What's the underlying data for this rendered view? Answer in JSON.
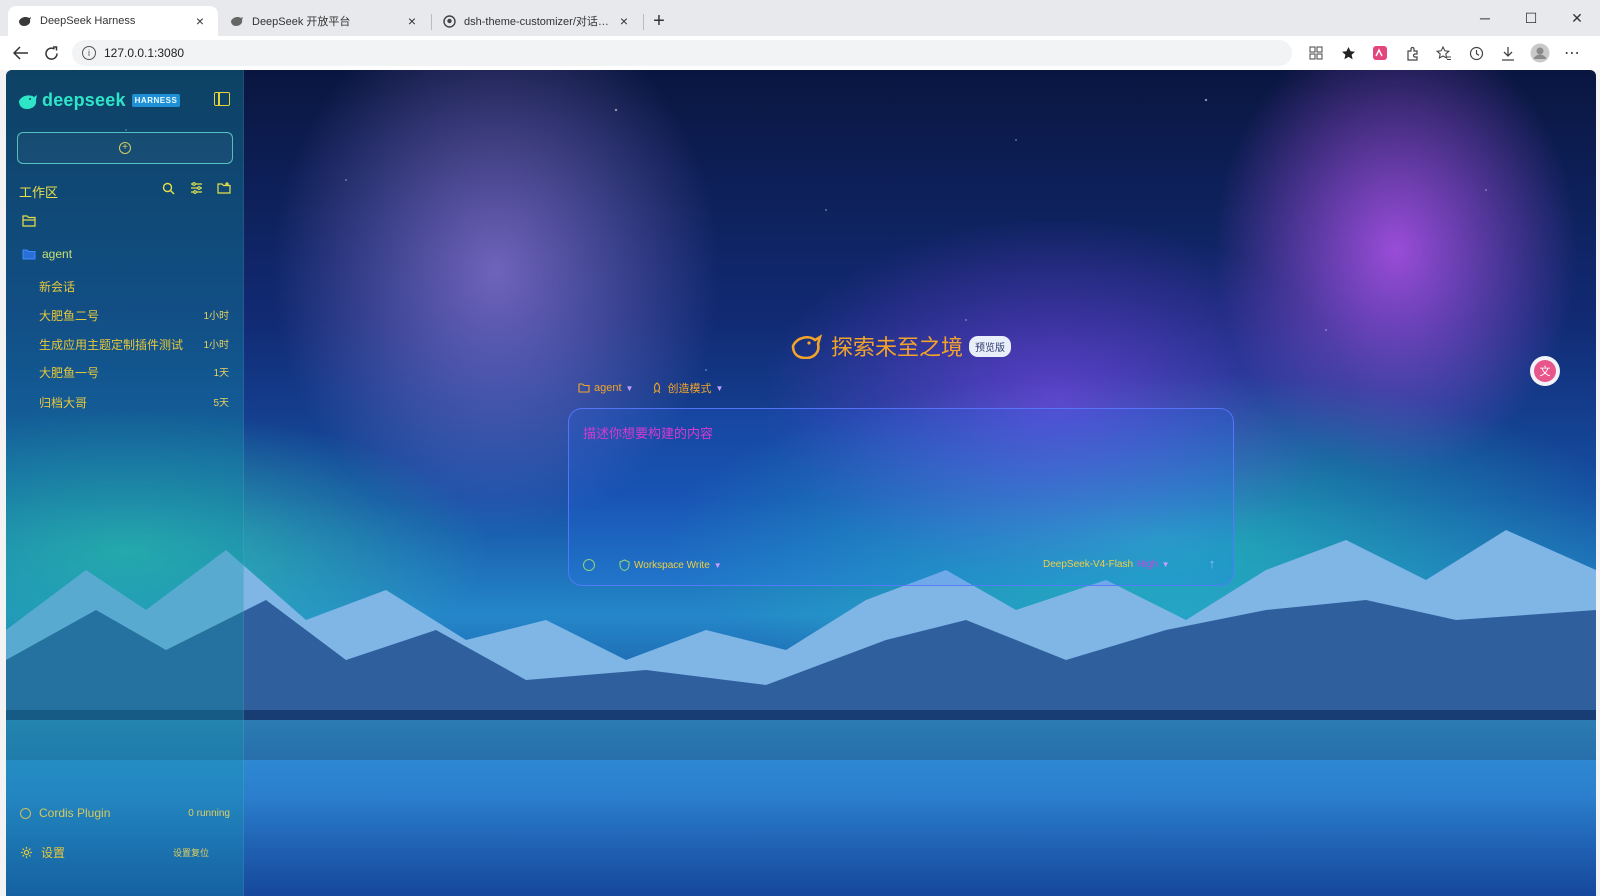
{
  "browser": {
    "tabs": [
      {
        "title": "DeepSeek Harness",
        "active": true
      },
      {
        "title": "DeepSeek 开放平台",
        "active": false
      },
      {
        "title": "dsh-theme-customizer/对话区测试",
        "active": false
      }
    ],
    "url": "127.0.0.1:3080",
    "new_tab_label": "+"
  },
  "sidebar": {
    "brand_name": "deepseek",
    "brand_badge": "HARNESS",
    "workspace_title": "工作区",
    "project_name": "agent",
    "sessions": [
      {
        "title": "新会话",
        "time": ""
      },
      {
        "title": "大肥鱼二号",
        "time": "1小时"
      },
      {
        "title": "生成应用主题定制插件测试",
        "time": "1小时"
      },
      {
        "title": "大肥鱼一号",
        "time": "1天"
      },
      {
        "title": "归档大哥",
        "time": "5天"
      }
    ],
    "plugin_label": "Cordis Plugin",
    "plugin_status": "0 running",
    "settings_label": "设置",
    "settings_reset": "设置复位"
  },
  "main": {
    "hero_title": "探索未至之境",
    "hero_badge": "预览版",
    "project_selector": "agent",
    "mode_selector": "创造模式",
    "composer_placeholder": "描述你想要构建的内容",
    "permission": "Workspace Write",
    "model_name": "DeepSeek-V4-Flash",
    "model_level": "High"
  },
  "colors": {
    "accent_teal": "#2ee6c7",
    "text_yellow": "#e8c83a",
    "hero_orange": "#f3a32a",
    "placeholder_magenta": "#d63ad2"
  }
}
